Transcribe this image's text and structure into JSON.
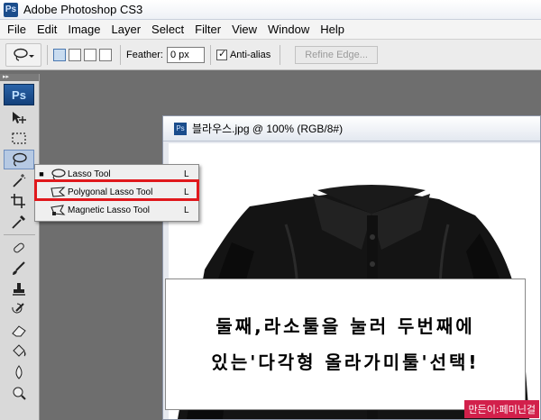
{
  "app": {
    "title": "Adobe Photoshop CS3",
    "logo_text": "Ps"
  },
  "menu": [
    "File",
    "Edit",
    "Image",
    "Layer",
    "Select",
    "Filter",
    "View",
    "Window",
    "Help"
  ],
  "options_bar": {
    "feather_label": "Feather:",
    "feather_value": "0 px",
    "antialias_label": "Anti-alias",
    "antialias_checked": true,
    "refine_edge_label": "Refine Edge..."
  },
  "tools_panel": {
    "logo_text": "Ps",
    "tools": [
      "move-tool",
      "marquee-tool",
      "lasso-tool",
      "magic-wand-tool",
      "crop-tool",
      "eyedropper-tool",
      "healing-brush-tool",
      "brush-tool",
      "clone-stamp-tool",
      "history-brush-tool",
      "eraser-tool",
      "paint-bucket-tool",
      "blur-tool",
      "dodge-tool"
    ]
  },
  "flyout": {
    "items": [
      {
        "label": "Lasso Tool",
        "key": "L",
        "selected": true
      },
      {
        "label": "Polygonal Lasso Tool",
        "key": "L",
        "selected": false
      },
      {
        "label": "Magnetic Lasso Tool",
        "key": "L",
        "selected": false
      }
    ]
  },
  "document": {
    "title": "블라우스.jpg @ 100% (RGB/8#)",
    "doc_icon_text": "Ps"
  },
  "annotation": {
    "line1": "둘째,라소툴을 눌러 두번째에",
    "line2": "있는'다각형 올라가미툴'선택!"
  },
  "watermark": "만든이:페미닌걸",
  "colors": {
    "highlight": "#e0181c",
    "watermark_bg": "#d2204b",
    "ps_blue": "#1b4d8c"
  }
}
